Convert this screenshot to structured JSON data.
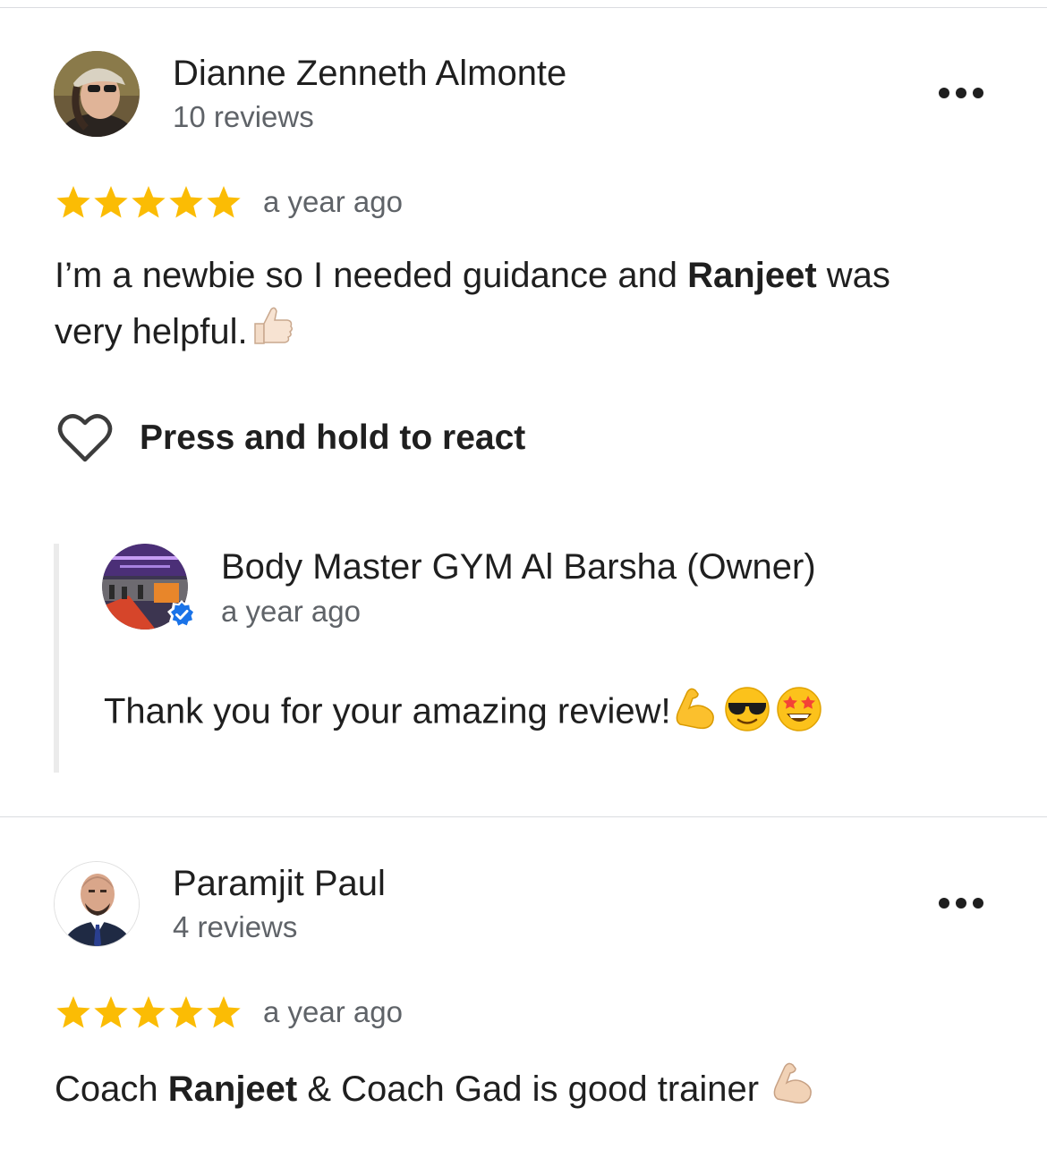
{
  "reviews": [
    {
      "reviewer": "Dianne Zenneth Almonte",
      "review_count": "10 reviews",
      "rating": 5,
      "time": "a year ago",
      "text_parts": [
        "I’m a newbie so I needed guidance and ",
        "Ranjeet",
        " was",
        "very helpful."
      ],
      "react_label": "Press and hold to react",
      "owner_reply": {
        "name": "Body Master GYM Al Barsha (Owner)",
        "time": "a year ago",
        "text": "Thank you for your amazing review!"
      }
    },
    {
      "reviewer": "Paramjit Paul",
      "review_count": "4 reviews",
      "rating": 5,
      "time": "a year ago",
      "text_parts": [
        "Coach ",
        "Ranjeet",
        " & Coach Gad is good trainer "
      ]
    }
  ],
  "colors": {
    "star": "#fbbc04",
    "verified_badge": "#1a73e8",
    "secondary_text": "#5f6368",
    "divider": "#dadce0"
  },
  "icons": {
    "more": "more-horiz-icon",
    "star": "star-icon",
    "heart": "heart-outline-icon",
    "verified": "verified-badge-icon",
    "thumbs_up": "thumbs-up-emoji",
    "flexed_biceps": "flexed-biceps-emoji",
    "sunglasses": "sunglasses-face-emoji",
    "star_struck": "star-struck-emoji"
  }
}
